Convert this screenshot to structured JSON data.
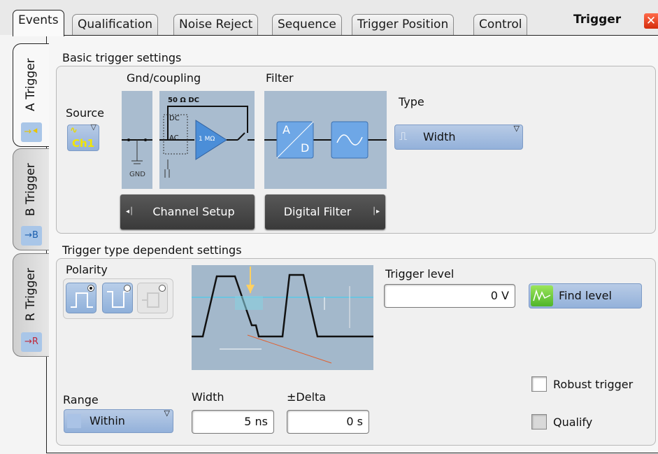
{
  "header": {
    "tabs": [
      {
        "label": "Events",
        "active": true
      },
      {
        "label": "Qualification",
        "active": false
      },
      {
        "label": "Noise Reject",
        "active": false
      },
      {
        "label": "Sequence",
        "active": false
      },
      {
        "label": "Trigger Position",
        "active": false
      },
      {
        "label": "Control",
        "active": false
      }
    ],
    "title": "Trigger",
    "close_icon": "close-x-icon"
  },
  "side_tabs": [
    {
      "label": "A Trigger",
      "icon_text": "→⯇",
      "active": true
    },
    {
      "label": "B Trigger",
      "icon_text": "→B",
      "active": false
    },
    {
      "label": "R Trigger",
      "icon_text": "→R",
      "active": false
    }
  ],
  "basic": {
    "title": "Basic trigger settings",
    "source_label": "Source",
    "source_value": "Ch1",
    "gnd_coupling_label": "Gnd/coupling",
    "coupling_dc_label": "50 Ω DC",
    "coupling_dc": "DC",
    "coupling_ac": "AC",
    "impedance": "1 MΩ",
    "gnd": "GND",
    "filter_label": "Filter",
    "ad_a": "A",
    "ad_d": "D",
    "type_label": "Type",
    "type_value": "Width",
    "channel_setup_label": "Channel Setup",
    "digital_filter_label": "Digital Filter"
  },
  "dependent": {
    "title": "Trigger type dependent settings",
    "polarity_label": "Polarity",
    "polarity_options": [
      {
        "icon": "positive-pulse-icon",
        "selected": true,
        "enabled": true
      },
      {
        "icon": "negative-pulse-icon",
        "selected": false,
        "enabled": true
      },
      {
        "icon": "either-pulse-icon",
        "selected": false,
        "enabled": false
      }
    ],
    "trigger_level_label": "Trigger level",
    "trigger_level_value": "0 V",
    "find_level_label": "Find level",
    "robust_trigger_label": "Robust trigger",
    "robust_trigger_checked": false,
    "qualify_label": "Qualify",
    "qualify_checked": false,
    "range_label": "Range",
    "range_value": "Within",
    "width_label": "Width",
    "width_value": "5 ns",
    "delta_label": "±Delta",
    "delta_value": "0 s"
  }
}
